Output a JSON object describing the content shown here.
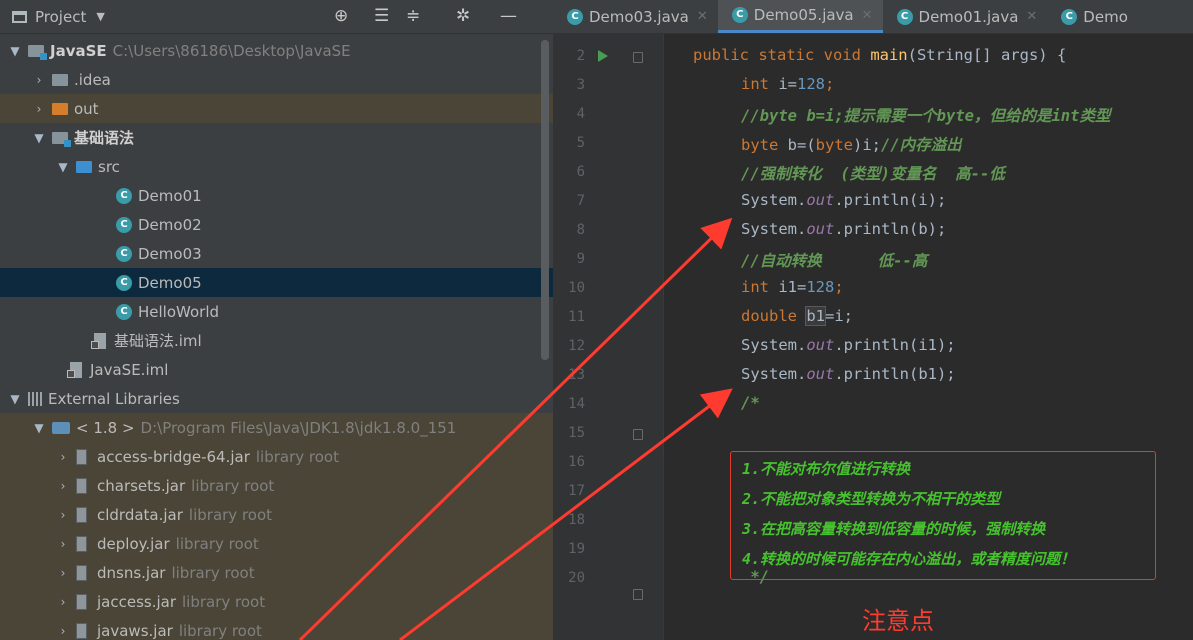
{
  "project_panel": {
    "title": "Project",
    "dropdown_icon": "chevron-down-icon",
    "toolbar_icons": [
      "target-icon",
      "collapse-all-icon",
      "expand-all-icon",
      "settings-icon",
      "minimize-icon"
    ]
  },
  "tree": [
    {
      "label": "JavaSE",
      "extra": "C:\\Users\\86186\\Desktop\\JavaSE",
      "icon": "module-folder-icon"
    },
    {
      "label": ".idea",
      "icon": "folder-icon"
    },
    {
      "label": "out",
      "icon": "folder-icon"
    },
    {
      "label": "基础语法",
      "icon": "module-folder-icon"
    },
    {
      "label": "src",
      "icon": "source-folder-icon"
    },
    {
      "label": "Demo01",
      "icon": "class-icon"
    },
    {
      "label": "Demo02",
      "icon": "class-icon"
    },
    {
      "label": "Demo03",
      "icon": "class-icon"
    },
    {
      "label": "Demo05",
      "icon": "class-icon"
    },
    {
      "label": "HelloWorld",
      "icon": "class-icon"
    },
    {
      "label": "基础语法.iml",
      "icon": "iml-file-icon"
    },
    {
      "label": "JavaSE.iml",
      "icon": "iml-file-icon"
    },
    {
      "label": "External Libraries",
      "icon": "libraries-icon"
    },
    {
      "label": "< 1.8 >",
      "extra": "D:\\Program Files\\Java\\JDK1.8\\jdk1.8.0_151",
      "icon": "jdk-icon"
    },
    {
      "label": "access-bridge-64.jar",
      "extra": "library root",
      "icon": "jar-icon"
    },
    {
      "label": "charsets.jar",
      "extra": "library root",
      "icon": "jar-icon"
    },
    {
      "label": "cldrdata.jar",
      "extra": "library root",
      "icon": "jar-icon"
    },
    {
      "label": "deploy.jar",
      "extra": "library root",
      "icon": "jar-icon"
    },
    {
      "label": "dnsns.jar",
      "extra": "library root",
      "icon": "jar-icon"
    },
    {
      "label": "jaccess.jar",
      "extra": "library root",
      "icon": "jar-icon"
    },
    {
      "label": "javaws.jar",
      "extra": "library root",
      "icon": "jar-icon"
    }
  ],
  "tabs": [
    {
      "label": "Demo03.java",
      "active": false
    },
    {
      "label": "Demo05.java",
      "active": true
    },
    {
      "label": "Demo01.java",
      "active": false
    },
    {
      "label": "Demo",
      "active": false
    }
  ],
  "editor": {
    "line_numbers": [
      "2",
      "3",
      "4",
      "5",
      "6",
      "7",
      "8",
      "9",
      "10",
      "11",
      "12",
      "13",
      "14",
      "15",
      "16",
      "17",
      "18",
      "19",
      "20"
    ],
    "code": {
      "l2_a": "public static void ",
      "l2_fn": "main",
      "l2_b": "(String[] args) {",
      "l3_kw": "int ",
      "l3_a": "i=",
      "l3_num": "128",
      "l3_b": ";",
      "l4": "//byte b=i;提示需要一个byte，但给的是int类型",
      "l5_kw": "byte ",
      "l5_a": "b=(",
      "l5_kw2": "byte",
      "l5_b": ")i;",
      "l5_c": "//内存溢出",
      "l6": "//强制转化  (类型)变量名  高--低",
      "l7_a": "System.",
      "l7_f": "out",
      "l7_b": ".println(i);",
      "l8_a": "System.",
      "l8_f": "out",
      "l8_b": ".println(b);",
      "l9": "//自动转换      低--高",
      "l10_kw": "int ",
      "l10_a": "i1=",
      "l10_num": "128",
      "l10_b": ";",
      "l11_kw": "double ",
      "l11_var": "b1",
      "l11_b": "=i;",
      "l12_a": "System.",
      "l12_f": "out",
      "l12_b": ".println(i1);",
      "l13_a": "System.",
      "l13_f": "out",
      "l13_b": ".println(b1);",
      "l14": "/*",
      "l19": " */"
    },
    "notes": [
      "1.不能对布尔值进行转换",
      "2.不能把对象类型转换为不相干的类型",
      "3.在把高容量转换到低容量的时候，强制转换",
      "4.转换的时候可能存在内心溢出，或者精度问题！"
    ],
    "caption": "注意点"
  },
  "colors": {
    "annotation_red": "#ff3b2f",
    "note_green": "#46c22e",
    "keyword": "#cc7832",
    "number": "#6897bb",
    "comment": "#629755"
  }
}
